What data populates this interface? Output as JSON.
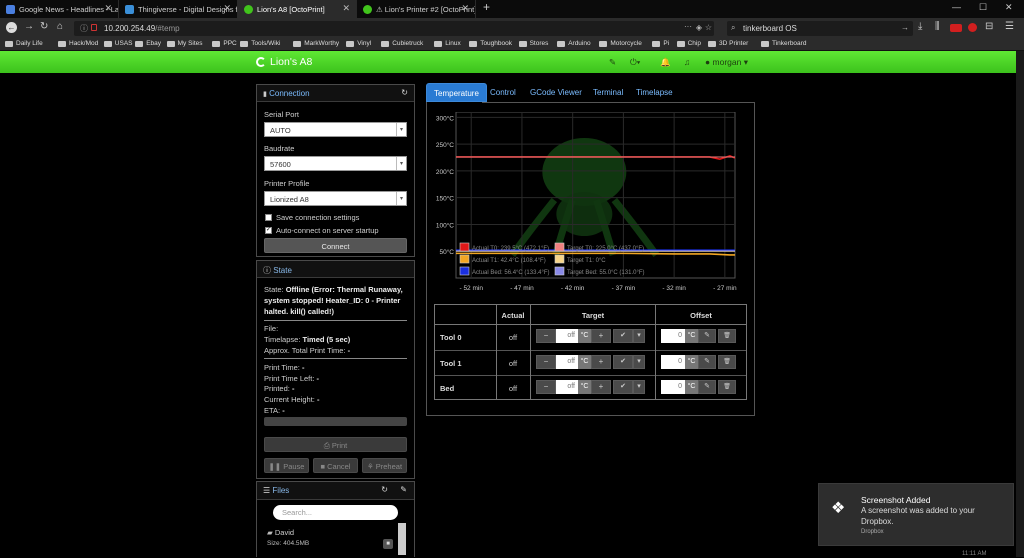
{
  "browser": {
    "tabs": [
      {
        "title": "Google News - Headlines - Latest",
        "favicon_color": "#4a7fe0",
        "active": false
      },
      {
        "title": "Thingiverse - Digital Designs for",
        "favicon_color": "#3a8fd8",
        "active": false
      },
      {
        "title": "Lion's A8 [OctoPrint]",
        "favicon_color": "#41c41c",
        "active": true
      },
      {
        "title": "⚠ Lion's Printer #2 [OctoPrint]",
        "favicon_color": "#41c41c",
        "active": false
      }
    ],
    "new_tab": "+",
    "window_buttons": {
      "minimize": "—",
      "maximize": "☐",
      "close": "✕"
    },
    "url": "10.200.254.49/#temp",
    "url_host": "10.200.254.49",
    "url_path": "/#temp",
    "search_value": "tinkerboard OS",
    "search_icon": "search-icon",
    "bookmarks": [
      "Daily Life",
      "Hack/Mod",
      "USAS",
      "Ebay",
      "My Sites",
      "PPC",
      "Tools/Wiki",
      "MarkWorthy",
      "Vinyl",
      "Cubietruck",
      "Linux",
      "Toughbook",
      "Stores",
      "Arduino",
      "Motorcycle",
      "Pi",
      "Chip",
      "3D Printer",
      "Tinkerboard"
    ]
  },
  "octoprint": {
    "brand": "Lion's A8",
    "user": "morgan",
    "accent": "#4fd627"
  },
  "connection": {
    "title": "Connection",
    "serial_port_label": "Serial Port",
    "serial_port_value": "AUTO",
    "baudrate_label": "Baudrate",
    "baudrate_value": "57600",
    "profile_label": "Printer Profile",
    "profile_value": "Lionized A8",
    "save_settings_label": "Save connection settings",
    "save_settings_checked": false,
    "autoconnect_label": "Auto-connect on server startup",
    "autoconnect_checked": true,
    "connect_button": "Connect"
  },
  "state": {
    "title": "State",
    "state_label": "State:",
    "state_line1": "Offline (Error: Thermal Runaway,",
    "state_line2": "system stopped! Heater_ID: 0 - Printer",
    "state_line3": "halted. kill() called!)",
    "file_label": "File:",
    "timelapse_label": "Timelapse:",
    "timelapse_value": "Timed (5 sec)",
    "approx_label": "Approx. Total Print Time:",
    "approx_value": "-",
    "print_time_label": "Print Time:",
    "print_time_value": "-",
    "print_time_left_label": "Print Time Left:",
    "print_time_left_value": "-",
    "printed_label": "Printed:",
    "printed_value": "-",
    "height_label": "Current Height:",
    "height_value": "-",
    "eta_label": "ETA:",
    "eta_value": "-",
    "print_button": "Print",
    "pause_button": "Pause",
    "cancel_button": "Cancel",
    "preheat_button": "Preheat"
  },
  "files": {
    "title": "Files",
    "search_placeholder": "Search...",
    "items": [
      {
        "name": "David",
        "size": "Size: 404.5MB"
      }
    ]
  },
  "main_tabs": [
    "Temperature",
    "Control",
    "GCode Viewer",
    "Terminal",
    "Timelapse"
  ],
  "chart_data": {
    "type": "line",
    "title": "",
    "xlabel": "",
    "ylabel": "",
    "x_ticks": [
      "- 52 min",
      "- 47 min",
      "- 42 min",
      "- 37 min",
      "- 32 min",
      "- 27 min"
    ],
    "y_ticks": [
      "300°C",
      "250°C",
      "200°C",
      "150°C",
      "100°C",
      "50°C"
    ],
    "ylim": [
      0,
      310
    ],
    "x": [
      -53.5,
      -52,
      -47,
      -42,
      -37,
      -32,
      -28.5,
      -27.5,
      -26.5,
      -26
    ],
    "grid": true,
    "legend_position": "bottom-left",
    "series": [
      {
        "name": "Actual T0: 239.5°C (472.1°F)",
        "color": "#e01818",
        "values": [
          226,
          226,
          226,
          226,
          226,
          226,
          226,
          222,
          228,
          224
        ]
      },
      {
        "name": "Target T0: 225.0°C (437.0°F)",
        "color": "#f08080",
        "values": [
          226,
          226,
          226,
          226,
          226,
          226,
          226,
          226,
          226,
          226
        ]
      },
      {
        "name": "Actual T1: 42.4°C (108.4°F)",
        "color": "#f2a623",
        "values": [
          46,
          46,
          46,
          46,
          46,
          45,
          45,
          44,
          43,
          43
        ]
      },
      {
        "name": "Target T1: 0°C",
        "color": "#f6d58a",
        "values": [
          50,
          50,
          50,
          50,
          50,
          50,
          50,
          50,
          50,
          50
        ]
      },
      {
        "name": "Actual Bed: 56.4°C (133.4°F)",
        "color": "#1a2fe0",
        "values": [
          52,
          52,
          52,
          52,
          52,
          52,
          52,
          52,
          52,
          52
        ]
      },
      {
        "name": "Target Bed: 55.0°C (131.0°F)",
        "color": "#8a8ae8",
        "values": [
          51,
          51,
          51,
          51,
          51,
          51,
          51,
          51,
          51,
          51
        ]
      }
    ]
  },
  "temp_table": {
    "headers": [
      "",
      "Actual",
      "Target",
      "Offset"
    ],
    "rows": [
      {
        "name": "Tool 0",
        "actual": "off",
        "target": "off",
        "offset": "0"
      },
      {
        "name": "Tool 1",
        "actual": "off",
        "target": "off",
        "offset": "0"
      },
      {
        "name": "Bed",
        "actual": "off",
        "target": "off",
        "offset": "0"
      }
    ],
    "unit": "°C",
    "minus": "−",
    "plus": "+",
    "check": "✔",
    "caret": "▾",
    "pencil": "✎",
    "trash": "🗑"
  },
  "toast": {
    "title": "Screenshot Added",
    "body_line1": "A screenshot was added to your",
    "body_line2": "Dropbox.",
    "app": "Dropbox"
  },
  "clock": "11:11 AM"
}
